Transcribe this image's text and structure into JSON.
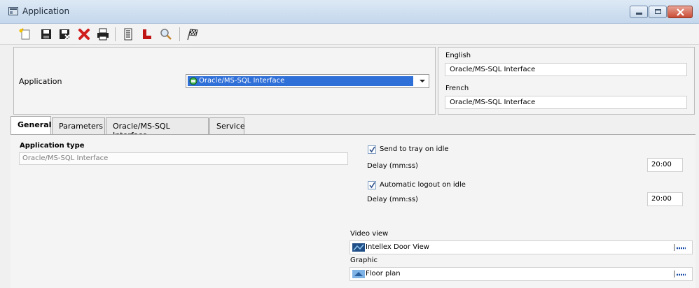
{
  "window": {
    "title": "Application"
  },
  "toolbar": {
    "icons": [
      "new-icon",
      "save-icon",
      "save-close-icon",
      "delete-icon",
      "print-icon",
      "list-icon",
      "hierarchy-icon",
      "search-icon",
      "finish-flag-icon"
    ]
  },
  "header": {
    "application_label": "Application",
    "application_value": "Oracle/MS-SQL Interface",
    "english_label": "English",
    "english_value": "Oracle/MS-SQL Interface",
    "french_label": "French",
    "french_value": "Oracle/MS-SQL Interface"
  },
  "tabs": [
    {
      "label": "General",
      "active": true
    },
    {
      "label": "Parameters",
      "active": false
    },
    {
      "label": "Oracle/MS-SQL Interface",
      "active": false
    },
    {
      "label": "Service",
      "active": false
    }
  ],
  "general": {
    "app_type_label": "Application type",
    "app_type_value": "Oracle/MS-SQL Interface",
    "send_tray_label": "Send to tray on idle",
    "send_tray_checked": true,
    "delay1_label": "Delay (mm:ss)",
    "delay1_value": "20:00",
    "auto_logout_label": "Automatic logout on idle",
    "auto_logout_checked": true,
    "delay2_label": "Delay (mm:ss)",
    "delay2_value": "20:00",
    "video_view_label": "Video view",
    "video_view_value": "Intellex Door View",
    "graphic_label": "Graphic",
    "graphic_value": "Floor plan"
  },
  "colors": {
    "selection": "#2f6fd8",
    "title_gradient_top": "#dde9f5",
    "close_button": "#c94c35"
  }
}
